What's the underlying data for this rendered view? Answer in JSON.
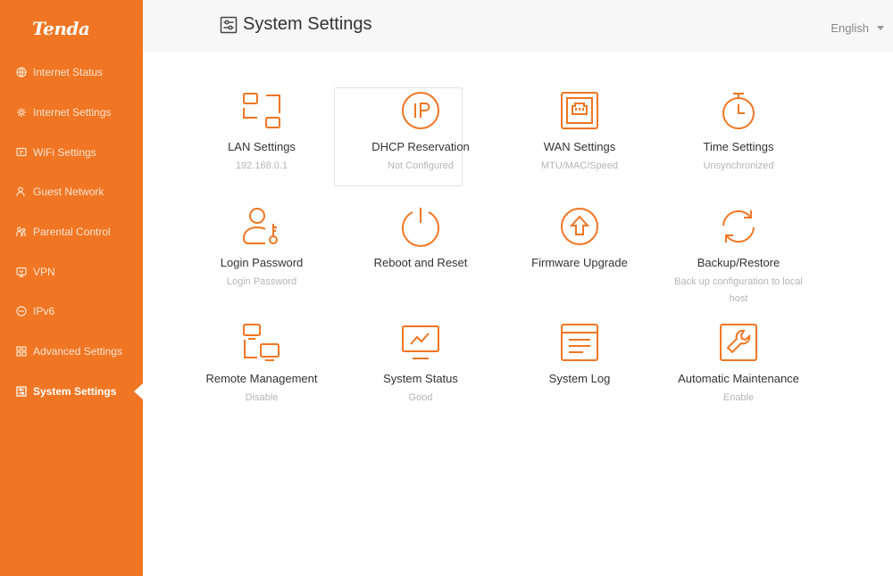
{
  "brand": {
    "logo_text": "Tenda",
    "accent": "#f07623"
  },
  "sidebar": {
    "items": [
      {
        "label": "Internet Status",
        "icon": "globe-icon",
        "active": false
      },
      {
        "label": "Internet Settings",
        "icon": "gear-icon",
        "active": false
      },
      {
        "label": "WiFi Settings",
        "icon": "wifi-icon",
        "active": false
      },
      {
        "label": "Guest Network",
        "icon": "guest-icon",
        "active": false
      },
      {
        "label": "Parental Control",
        "icon": "parental-icon",
        "active": false
      },
      {
        "label": "VPN",
        "icon": "vpn-icon",
        "active": false
      },
      {
        "label": "IPv6",
        "icon": "ipv6-icon",
        "active": false
      },
      {
        "label": "Advanced Settings",
        "icon": "grid-icon",
        "active": false
      },
      {
        "label": "System Settings",
        "icon": "settings-panel-icon",
        "active": true
      }
    ]
  },
  "header": {
    "title": "System Settings",
    "language": "English"
  },
  "tiles": [
    {
      "label": "LAN Settings",
      "sub": "192.168.0.1",
      "icon": "lan-icon"
    },
    {
      "label": "DHCP Reservation",
      "sub": "Not Configured",
      "icon": "ip-icon"
    },
    {
      "label": "WAN Settings",
      "sub": "MTU/MAC/Speed",
      "icon": "ethernet-port-icon"
    },
    {
      "label": "Time Settings",
      "sub": "Unsynchronized",
      "icon": "stopwatch-icon"
    },
    {
      "label": "Login Password",
      "sub": "Login Password",
      "icon": "user-key-icon"
    },
    {
      "label": "Reboot and Reset",
      "sub": "",
      "icon": "power-icon"
    },
    {
      "label": "Firmware Upgrade",
      "sub": "",
      "icon": "upgrade-icon"
    },
    {
      "label": "Backup/Restore",
      "sub": "Back up configuration to local host",
      "icon": "refresh-icon"
    },
    {
      "label": "Remote Management",
      "sub": "Disable",
      "icon": "remote-icon"
    },
    {
      "label": "System Status",
      "sub": "Good",
      "icon": "monitor-icon"
    },
    {
      "label": "System Log",
      "sub": "",
      "icon": "log-icon"
    },
    {
      "label": "Automatic Maintenance",
      "sub": "Enable",
      "icon": "wrench-icon"
    }
  ]
}
